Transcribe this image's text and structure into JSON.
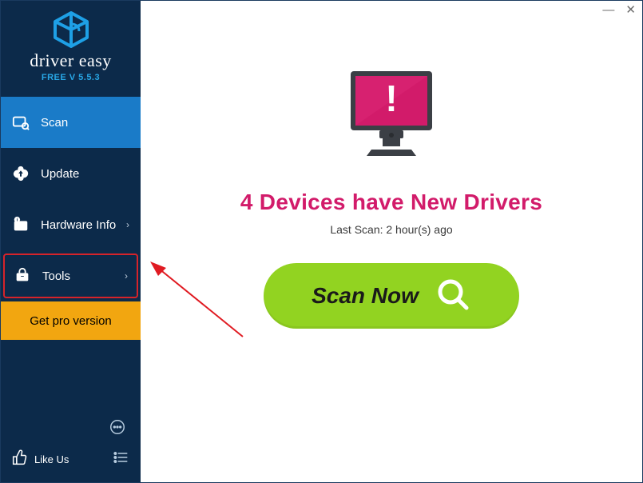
{
  "brand": {
    "name": "driver easy",
    "version": "FREE V 5.5.3"
  },
  "sidebar": {
    "items": [
      {
        "label": "Scan"
      },
      {
        "label": "Update"
      },
      {
        "label": "Hardware Info"
      },
      {
        "label": "Tools"
      }
    ],
    "pro_label": "Get pro version",
    "like_label": "Like Us"
  },
  "main": {
    "headline": "4 Devices have New Drivers",
    "last_scan": "Last Scan: 2 hour(s) ago",
    "scan_button": "Scan Now"
  },
  "colors": {
    "accent_pink": "#d21b6a",
    "scan_green": "#92d321",
    "pro_orange": "#f2a610",
    "sidebar_bg": "#0c2a4a",
    "active_blue": "#1a7bc8",
    "highlight_red": "#d6232a"
  }
}
